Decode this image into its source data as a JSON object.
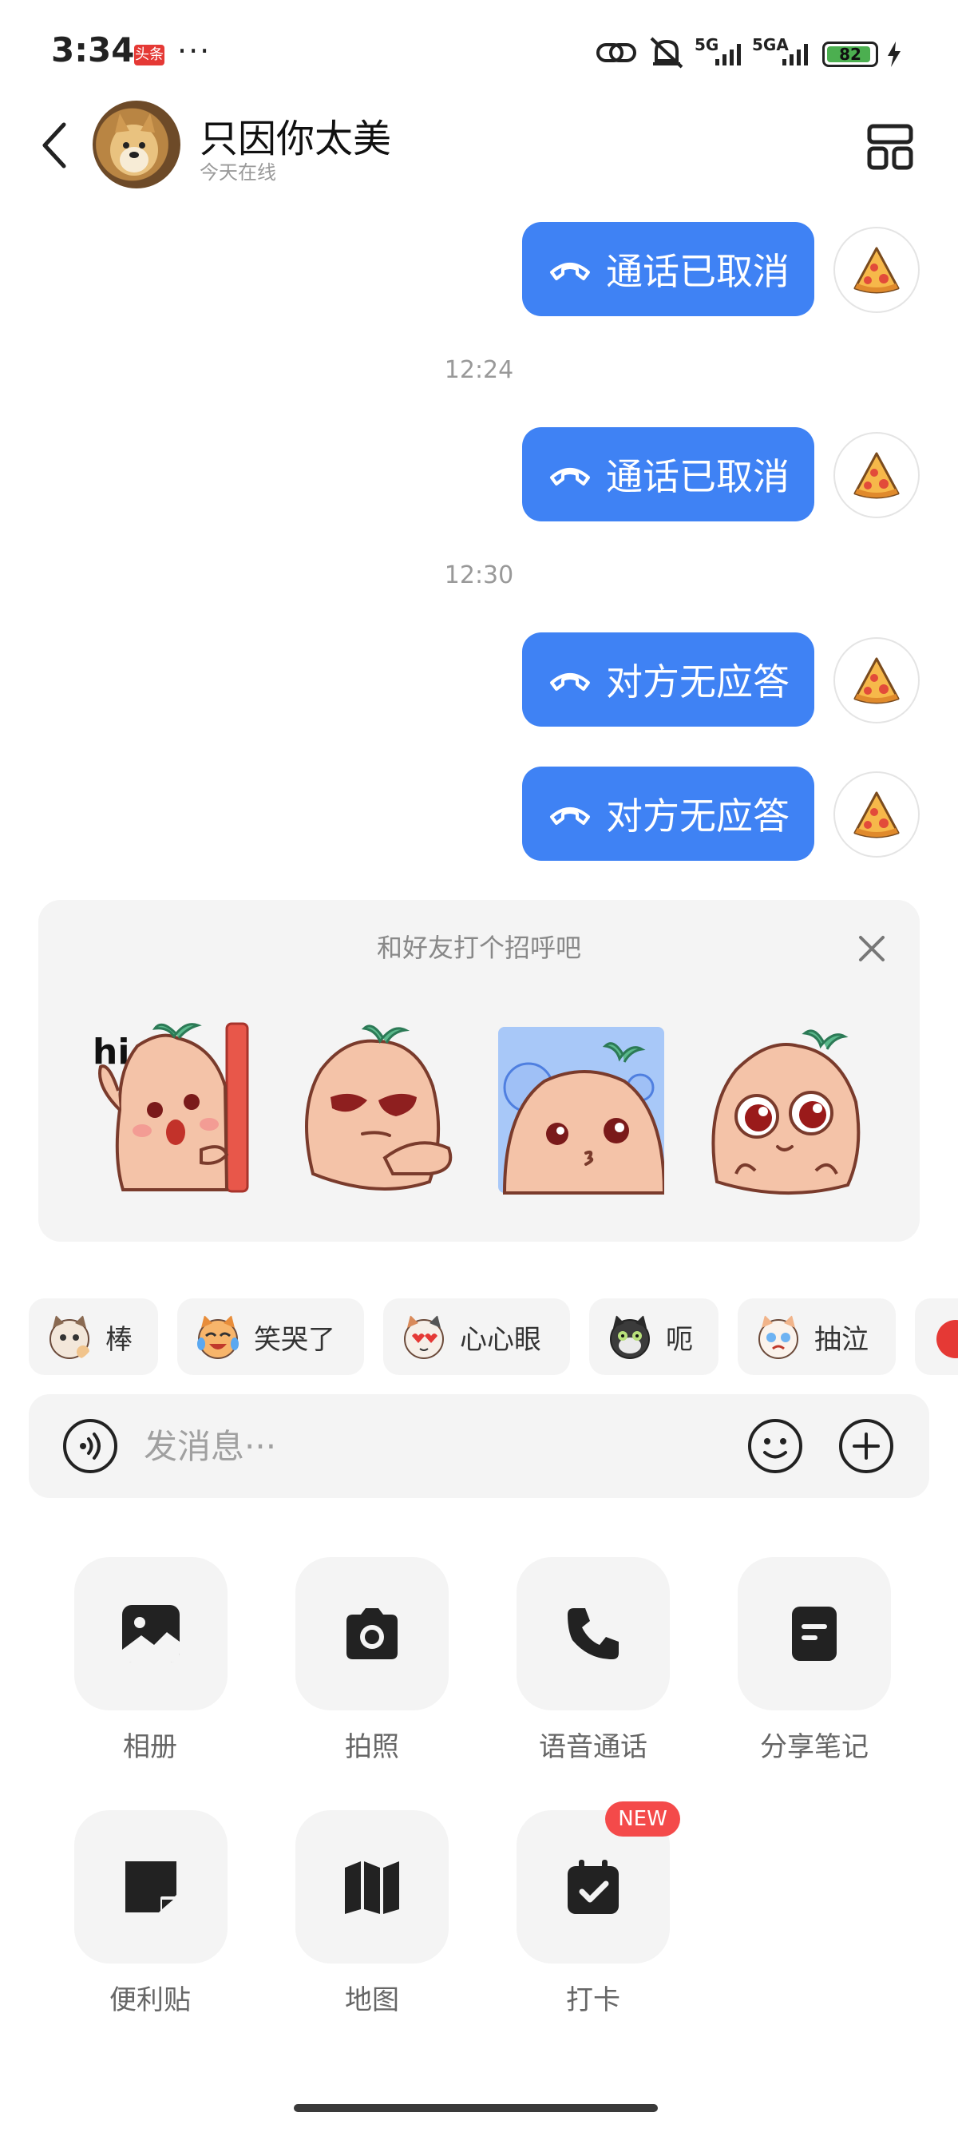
{
  "status_bar": {
    "time": "3:34",
    "badge": "头条",
    "more": "···",
    "signal_1": "5G",
    "signal_2": "5GA",
    "battery": "82"
  },
  "header": {
    "contact_name": "只因你太美",
    "contact_status": "今天在线"
  },
  "messages": [
    {
      "text": "通话已取消"
    },
    {
      "timestamp": "12:24"
    },
    {
      "text": "通话已取消"
    },
    {
      "timestamp": "12:30"
    },
    {
      "text": "对方无应答"
    },
    {
      "text": "对方无应答"
    }
  ],
  "greeting": {
    "title": "和好友打个招呼吧",
    "sticker_1_text": "hi"
  },
  "quick_emojis": [
    "棒",
    "笑哭了",
    "心心眼",
    "呃",
    "抽泣"
  ],
  "input": {
    "placeholder": "发消息···"
  },
  "tools": [
    {
      "label": "相册",
      "icon": "album-icon"
    },
    {
      "label": "拍照",
      "icon": "camera-icon"
    },
    {
      "label": "语音通话",
      "icon": "phone-icon"
    },
    {
      "label": "分享笔记",
      "icon": "note-icon"
    },
    {
      "label": "便利贴",
      "icon": "sticky-note-icon"
    },
    {
      "label": "地图",
      "icon": "map-icon"
    },
    {
      "label": "打卡",
      "icon": "checkin-icon",
      "badge": "NEW"
    }
  ],
  "colors": {
    "bubble": "#3f82f4",
    "panel": "#f4f4f4",
    "badge_red": "#f44a4a"
  }
}
